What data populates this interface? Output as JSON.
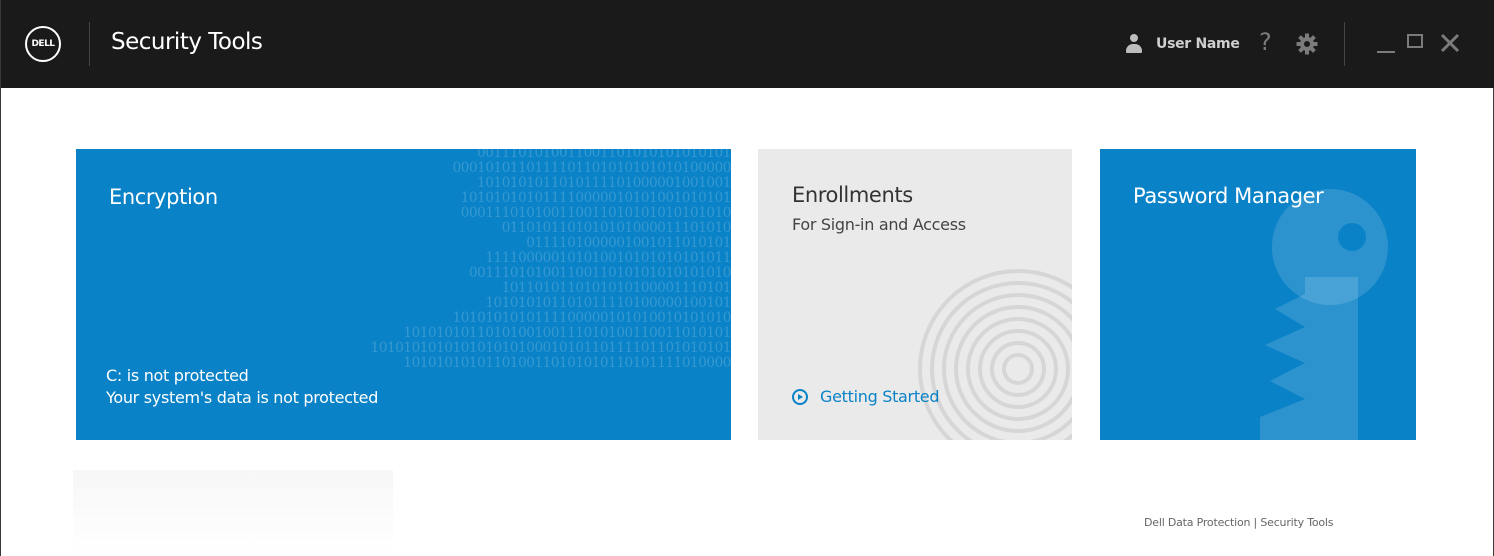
{
  "app": {
    "logo_text": "DELL",
    "title": "Security Tools"
  },
  "header": {
    "user_name": "User Name",
    "help_glyph": "?",
    "icons": [
      "user-icon",
      "help-icon",
      "gear-icon",
      "minimize-icon",
      "maximize-icon",
      "close-icon"
    ]
  },
  "tiles": {
    "encryption": {
      "title": "Encryption",
      "status_line1": "C: is not protected",
      "status_line2": "Your system's data is not protected",
      "binary_rows": [
        "0011101010011001101010101010101",
        "0001010110111101101010101010100000",
        "1010101011010111101000001001001",
        "101010101011110000010101001010101",
        "000111010100110011010101010101010",
        "0110101101010101000011101010",
        "0111101000001001011010101",
        "111100000101010010101010101011",
        "00111010100110011010101010101010",
        "1011010110101010100001110101",
        "101010101101011110100000100101",
        "1010101010111100000101010010101010",
        "1010101011010100100111010100110011010101",
        "10101010101010101010001010110111101101010101",
        "1010101010110100110101010110101111010000"
      ],
      "color": "#0a82c7"
    },
    "enrollments": {
      "title": "Enrollments",
      "subtitle": "For Sign-in and Access",
      "link_label": "Getting Started",
      "color": "#eaeaea"
    },
    "password_manager": {
      "title": "Password Manager",
      "color": "#0a82c7"
    }
  },
  "footer": {
    "text": "Dell Data Protection | Security Tools"
  }
}
